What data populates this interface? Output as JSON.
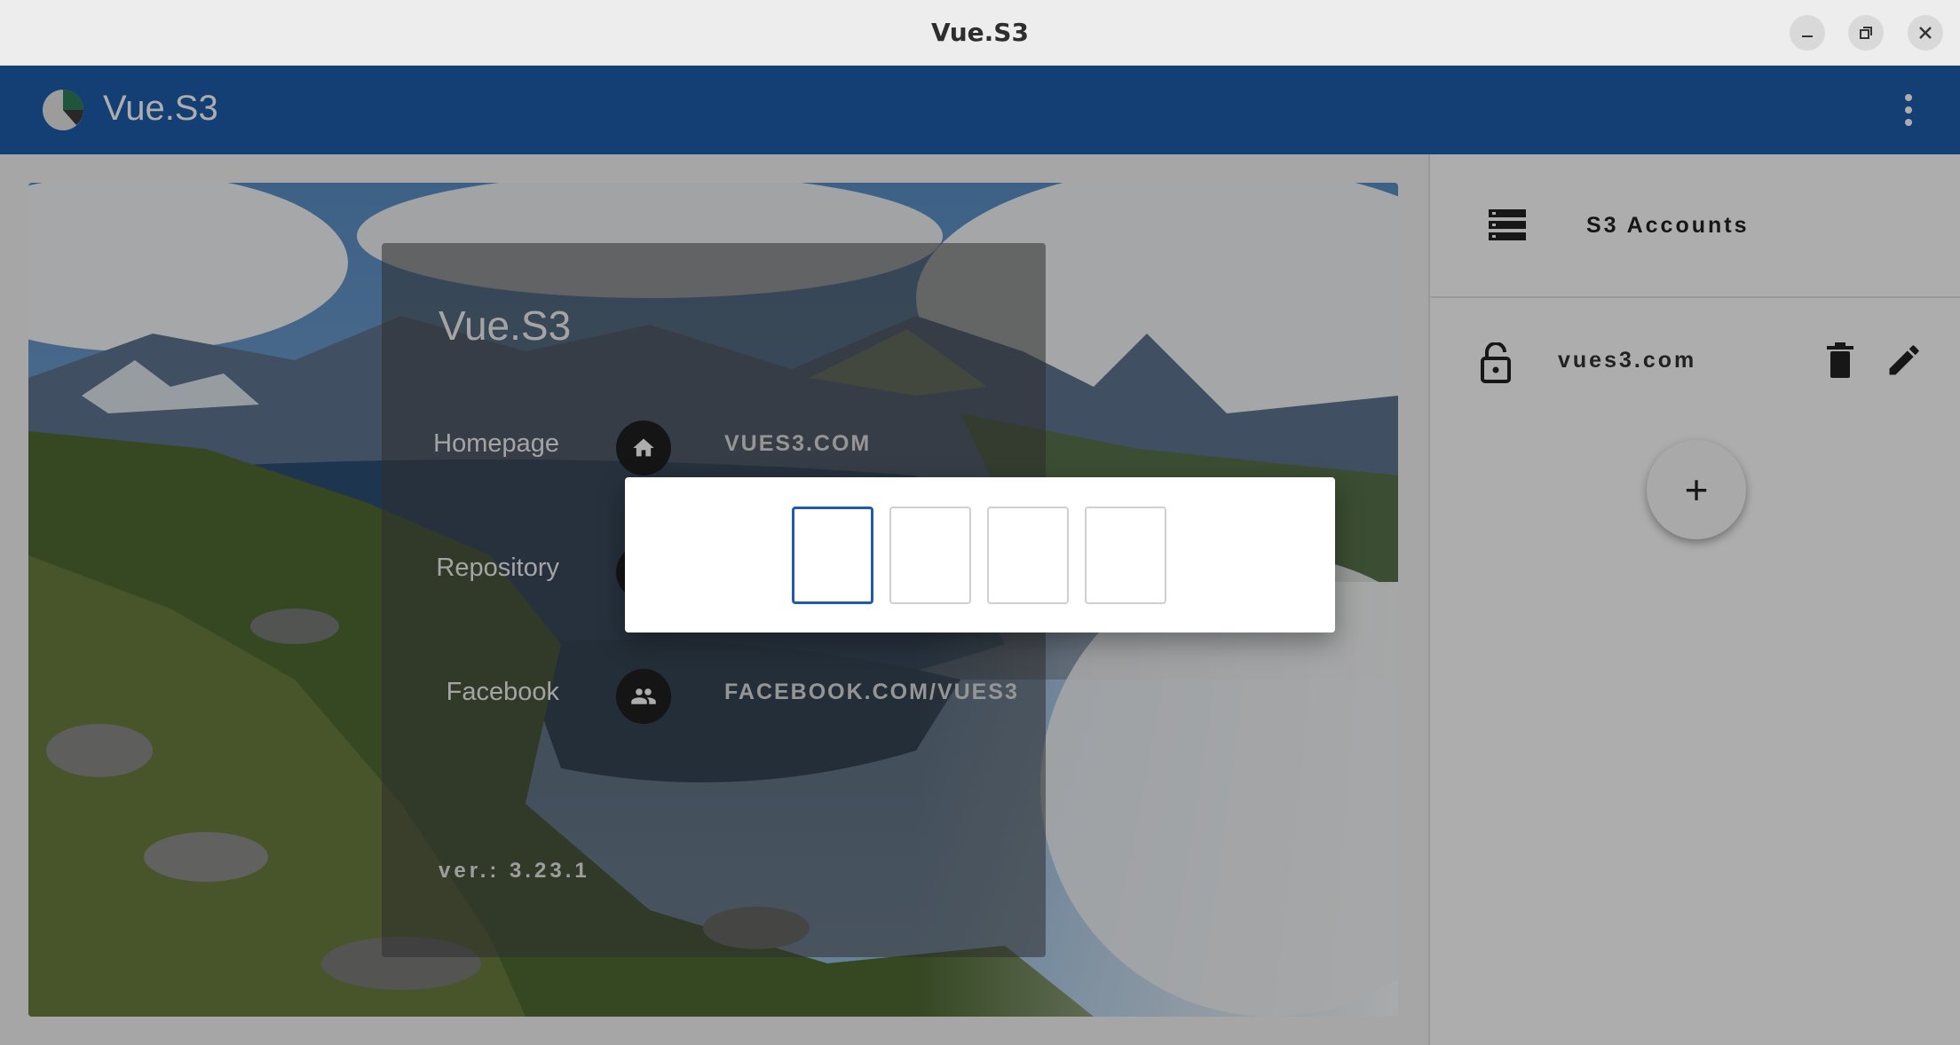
{
  "window": {
    "title": "Vue.S3",
    "controls": [
      "minimize",
      "restore",
      "close"
    ]
  },
  "appbar": {
    "title": "Vue.S3",
    "color": "#1d5dab"
  },
  "info_card": {
    "title": "Vue.S3",
    "links": [
      {
        "label": "Homepage",
        "icon": "home-icon",
        "url": "VUES3.COM"
      },
      {
        "label": "Repository",
        "icon": "code-icon",
        "url": ""
      },
      {
        "label": "Facebook",
        "icon": "people-icon",
        "url": "FACEBOOK.COM/VUES3"
      }
    ],
    "version": "ver.: 3.23.1"
  },
  "sidebar": {
    "title": "S3 Accounts",
    "accounts": [
      {
        "name": "vues3.com",
        "icon": "lock-open-icon"
      }
    ],
    "add_label": "+"
  },
  "pin_dialog": {
    "digits": [
      "",
      "",
      "",
      ""
    ],
    "active_index": 0,
    "accent": "#1d5dab"
  }
}
